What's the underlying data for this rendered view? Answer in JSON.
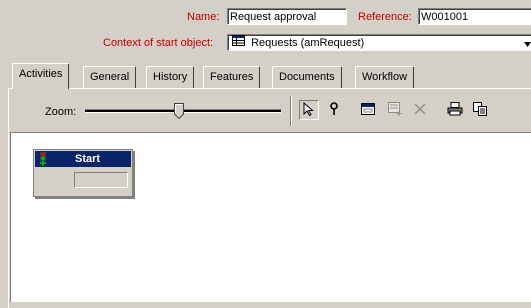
{
  "header": {
    "name_label": "Name:",
    "name_value": "Request approval",
    "reference_label": "Reference:",
    "reference_value": "W001001",
    "context_label": "Context of start object:",
    "context_value": "Requests (amRequest)"
  },
  "tabs": [
    {
      "label": "Activities",
      "active": true
    },
    {
      "label": "General"
    },
    {
      "label": "History"
    },
    {
      "label": "Features"
    },
    {
      "label": "Documents"
    },
    {
      "label": "Workflow"
    }
  ],
  "toolbar": {
    "zoom_label": "Zoom:",
    "zoom_level": 0.48
  },
  "canvas": {
    "start_node_label": "Start"
  }
}
